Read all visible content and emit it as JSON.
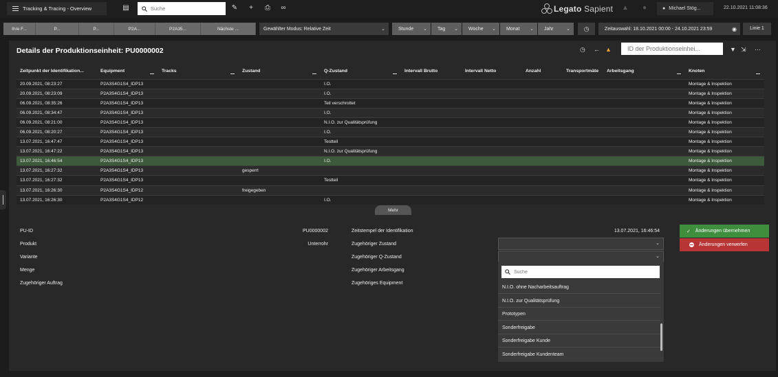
{
  "topbar": {
    "app_title": "Tracking & Tracing - Overview",
    "search_placeholder": "Suche",
    "logo_bold": "Legato",
    "logo_light": " Sapient",
    "user_name": "Michael Stög...",
    "datetime": "22.10.2021 11:08:36"
  },
  "filterbar": {
    "tabs": [
      "Ihre F...",
      "P...",
      "P...",
      "P2A...",
      "P2A35...",
      "Nächste ..."
    ],
    "mode": "Gewählter Modus: Relative Zeit",
    "time_units": [
      "Stunde",
      "Tag",
      "Woche",
      "Monat",
      "Jahr"
    ],
    "time_range": "Zeitauswahl: 18.10.2021 00:00 - 24.10.2021 23:59",
    "line": "Linie 1"
  },
  "panel": {
    "title": "Details der Produktionseinheit: PU0000002",
    "search_placeholder": "ID der Produktionseinhei..."
  },
  "table": {
    "columns": [
      "Zeitpunkt der Identifikation...",
      "Equipment",
      "Tracks",
      "Zustand",
      "Q-Zustand",
      "Intervall Brutto",
      "Intervall Netto",
      "Anzahl",
      "Transportmäte",
      "Arbeitsgang",
      "Knoten"
    ],
    "rows": [
      [
        "20.09.2021, 08:23:27",
        "P2A3S4G1S4_IDP13",
        "",
        "",
        "I.O.",
        "",
        "",
        "",
        "",
        "",
        "Montage & Inspektion"
      ],
      [
        "20.09.2021, 08:23:09",
        "P2A3S4G1S4_IDP13",
        "",
        "",
        "I.O.",
        "",
        "",
        "",
        "",
        "",
        "Montage & Inspektion"
      ],
      [
        "06.09.2021, 08:35:26",
        "P2A3S4G1S4_IDP13",
        "",
        "",
        "Teil verschrottet",
        "",
        "",
        "",
        "",
        "",
        "Montage & Inspektion"
      ],
      [
        "06.09.2021, 08:34:47",
        "P2A3S4G1S4_IDP13",
        "",
        "",
        "I.O.",
        "",
        "",
        "",
        "",
        "",
        "Montage & Inspektion"
      ],
      [
        "06.09.2021, 08:21:00",
        "P2A3S4G1S4_IDP13",
        "",
        "",
        "N.I.O. zur Qualitätsprüfung",
        "",
        "",
        "",
        "",
        "",
        "Montage & Inspektion"
      ],
      [
        "06.09.2021, 08:20:27",
        "P2A3S4G1S4_IDP13",
        "",
        "",
        "I.O.",
        "",
        "",
        "",
        "",
        "",
        "Montage & Inspektion"
      ],
      [
        "13.07.2021, 16:47:47",
        "P2A3S4G1S4_IDP13",
        "",
        "",
        "Testteil",
        "",
        "",
        "",
        "",
        "",
        "Montage & Inspektion"
      ],
      [
        "13.07.2021, 16:47:22",
        "P2A3S4G1S4_IDP13",
        "",
        "",
        "N.I.O. zur Qualitätsprüfung",
        "",
        "",
        "",
        "",
        "",
        "Montage & Inspektion"
      ],
      [
        "13.07.2021, 16:46:54",
        "P2A3S4G1S4_IDP13",
        "",
        "",
        "I.O.",
        "",
        "",
        "",
        "",
        "",
        "Montage & Inspektion"
      ],
      [
        "13.07.2021, 16:27:32",
        "P2A3S4G1S4_IDP13",
        "",
        "gesperrt",
        "",
        "",
        "",
        "",
        "",
        "",
        "Montage & Inspektion"
      ],
      [
        "13.07.2021, 16:27:32",
        "P2A3S4G1S4_IDP13",
        "",
        "",
        "Testteil",
        "",
        "",
        "",
        "",
        "",
        "Montage & Inspektion"
      ],
      [
        "13.07.2021, 16:26:30",
        "P2A3S4G1S4_IDP12",
        "",
        "freigegeben",
        "",
        "",
        "",
        "",
        "",
        "",
        "Montage & Inspektion"
      ],
      [
        "13.07.2021, 16:26:30",
        "P2A3S4G1S4_IDP12",
        "",
        "",
        "I.O.",
        "",
        "",
        "",
        "",
        "",
        "Montage & Inspektion"
      ]
    ],
    "selected_row": 8,
    "more_label": "Mehr"
  },
  "details": {
    "left_labels": [
      "PU-ID",
      "Produkt",
      "Variante",
      "Menge",
      "Zugehöriger Auftrag"
    ],
    "left_values": [
      "PU0000002",
      "Unterrohr",
      "",
      "",
      ""
    ],
    "mid_labels": [
      "Zeitstempel der Identifikation",
      "Zugehöriger Zustand",
      "Zugehöriger Q-Zustand",
      "Zugehöriger Arbeitsgang",
      "Zugehöriges Equipment"
    ],
    "timestamp": "13.07.2021, 16:46:54"
  },
  "dropdown": {
    "search_placeholder": "Suche",
    "options": [
      "N.I.O. ohne Nacharbeitsauftrag",
      "N.I.O. zur Qualitätsprüfung",
      "Prototypen",
      "Sonderfreigabe",
      "Sonderfreigabe Kunde",
      "Sonderfreigabe Kundenteam"
    ]
  },
  "actions": {
    "apply": "Änderungen übernehmen",
    "discard": "Änderungen verwerfen"
  },
  "colors": {
    "selected_row": "#3d5a3d",
    "apply": "#3e8e3e",
    "discard": "#b83535",
    "warning": "#e8a33a"
  }
}
